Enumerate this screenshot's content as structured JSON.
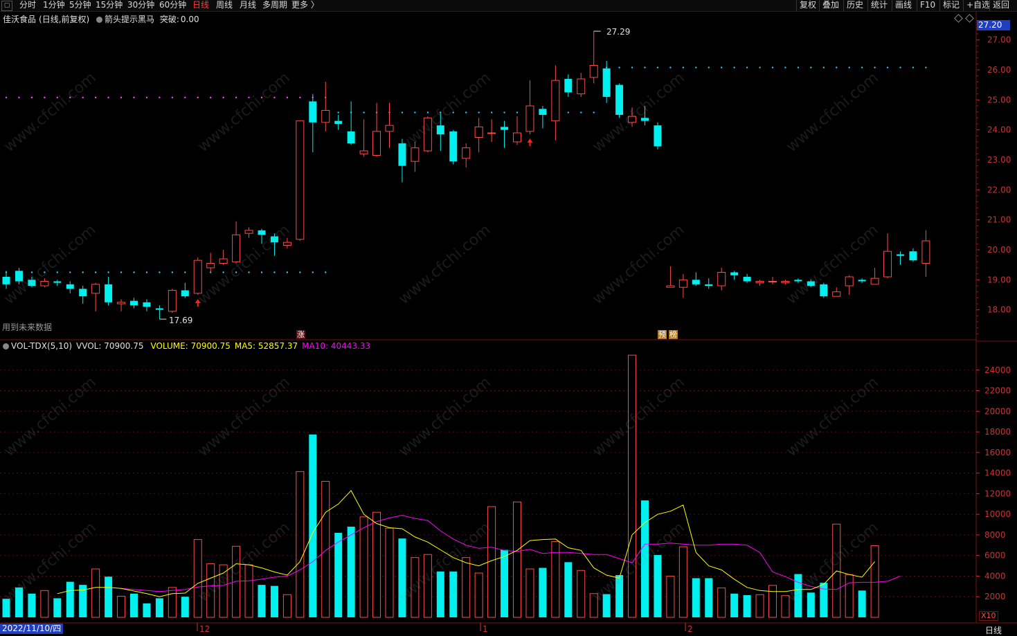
{
  "toolbar": {
    "left": [
      "分时",
      "1分钟",
      "5分钟",
      "15分钟",
      "30分钟",
      "60分钟",
      "日线",
      "周线",
      "月线",
      "多周期",
      "更多 〉"
    ],
    "active_index": 6,
    "right": [
      "复权",
      "叠加",
      "历史",
      "统计",
      "画线",
      "F10",
      "标记",
      "+自选",
      "返回"
    ]
  },
  "header": {
    "stock": "佳沃食品",
    "period": "(日线,前复权)",
    "indicator_name": "箭头提示黑马",
    "breakout_label": "突破:",
    "breakout_value": "0.00",
    "current_price_box": "27.20"
  },
  "price_panel": {
    "note": "用到未来数据",
    "high_label": "27.29",
    "low_label": "17.69",
    "y_ticks": [
      "27.00",
      "26.00",
      "25.00",
      "24.00",
      "23.00",
      "22.00",
      "21.00",
      "20.00",
      "19.00",
      "18.00"
    ],
    "markers": [
      "涨",
      "预",
      "榜"
    ]
  },
  "volume_panel": {
    "legend": {
      "title": "VOL-TDX(5,10)",
      "vvol": "VVOL: 70900.75",
      "volume": "VOLUME: 70900.75",
      "ma5": "MA5: 52857.37",
      "ma10": "MA10: 40443.33"
    },
    "y_ticks": [
      "24000",
      "22000",
      "20000",
      "18000",
      "16000",
      "14000",
      "12000",
      "10000",
      "8000",
      "6000",
      "4000",
      "2000"
    ],
    "unit": "X10"
  },
  "bottom_axis": {
    "date": "2022/11/10/四",
    "month_marks": [
      "12",
      "1",
      "2"
    ],
    "period_label": "日线"
  },
  "colors": {
    "up": "#ff4a4a",
    "down": "#00f0f0",
    "ma5": "#ffff00",
    "ma10": "#ff00ff",
    "grid": "#7a1010"
  },
  "chart_data": {
    "type": "candlestick+volume",
    "candles": [
      {
        "o": 19.1,
        "c": 18.85,
        "h": 19.3,
        "l": 18.7
      },
      {
        "o": 19.3,
        "c": 18.95,
        "h": 19.4,
        "l": 18.85
      },
      {
        "o": 19.0,
        "c": 18.8,
        "h": 19.1,
        "l": 18.75
      },
      {
        "o": 18.8,
        "c": 18.95,
        "h": 19.05,
        "l": 18.75
      },
      {
        "o": 18.95,
        "c": 18.9,
        "h": 19.0,
        "l": 18.8
      },
      {
        "o": 18.85,
        "c": 18.7,
        "h": 18.95,
        "l": 18.55
      },
      {
        "o": 18.7,
        "c": 18.45,
        "h": 18.8,
        "l": 18.2
      },
      {
        "o": 18.55,
        "c": 18.85,
        "h": 18.9,
        "l": 17.95
      },
      {
        "o": 18.85,
        "c": 18.25,
        "h": 19.1,
        "l": 18.15
      },
      {
        "o": 18.2,
        "c": 18.25,
        "h": 18.35,
        "l": 17.95
      },
      {
        "o": 18.3,
        "c": 18.15,
        "h": 18.4,
        "l": 18.05
      },
      {
        "o": 18.25,
        "c": 18.1,
        "h": 18.35,
        "l": 17.95
      },
      {
        "o": 18.05,
        "c": 18.0,
        "h": 18.15,
        "l": 17.69
      },
      {
        "o": 17.95,
        "c": 18.65,
        "h": 18.7,
        "l": 17.9
      },
      {
        "o": 18.65,
        "c": 18.45,
        "h": 18.9,
        "l": 18.4
      },
      {
        "o": 18.55,
        "c": 19.65,
        "h": 19.75,
        "l": 18.5
      },
      {
        "o": 19.4,
        "c": 19.55,
        "h": 19.9,
        "l": 19.25
      },
      {
        "o": 19.55,
        "c": 19.7,
        "h": 20.0,
        "l": 19.5
      },
      {
        "o": 19.6,
        "c": 20.5,
        "h": 20.95,
        "l": 19.55
      },
      {
        "o": 20.55,
        "c": 20.65,
        "h": 20.75,
        "l": 20.4
      },
      {
        "o": 20.65,
        "c": 20.5,
        "h": 20.7,
        "l": 20.2
      },
      {
        "o": 20.45,
        "c": 20.25,
        "h": 20.55,
        "l": 19.8
      },
      {
        "o": 20.15,
        "c": 20.25,
        "h": 20.4,
        "l": 20.05
      },
      {
        "o": 20.35,
        "c": 24.3,
        "h": 24.3,
        "l": 20.3
      },
      {
        "o": 24.95,
        "c": 24.25,
        "h": 25.2,
        "l": 23.25
      },
      {
        "o": 24.25,
        "c": 24.65,
        "h": 25.6,
        "l": 23.95
      },
      {
        "o": 24.3,
        "c": 24.2,
        "h": 24.5,
        "l": 24.0
      },
      {
        "o": 23.95,
        "c": 23.55,
        "h": 24.95,
        "l": 23.5
      },
      {
        "o": 23.2,
        "c": 23.3,
        "h": 24.35,
        "l": 23.1
      },
      {
        "o": 23.15,
        "c": 23.95,
        "h": 24.9,
        "l": 23.1
      },
      {
        "o": 23.95,
        "c": 24.15,
        "h": 24.9,
        "l": 23.4
      },
      {
        "o": 23.55,
        "c": 22.8,
        "h": 23.7,
        "l": 22.25
      },
      {
        "o": 22.95,
        "c": 23.4,
        "h": 23.6,
        "l": 22.6
      },
      {
        "o": 23.3,
        "c": 24.4,
        "h": 24.45,
        "l": 23.25
      },
      {
        "o": 24.15,
        "c": 23.85,
        "h": 24.55,
        "l": 23.3
      },
      {
        "o": 23.95,
        "c": 22.95,
        "h": 24.0,
        "l": 22.85
      },
      {
        "o": 23.05,
        "c": 23.4,
        "h": 23.55,
        "l": 22.75
      },
      {
        "o": 23.75,
        "c": 24.1,
        "h": 24.4,
        "l": 23.25
      },
      {
        "o": 23.9,
        "c": 23.9,
        "h": 24.35,
        "l": 23.6
      },
      {
        "o": 24.1,
        "c": 24.0,
        "h": 24.3,
        "l": 23.4
      },
      {
        "o": 23.6,
        "c": 23.9,
        "h": 24.45,
        "l": 23.5
      },
      {
        "o": 23.95,
        "c": 24.8,
        "h": 25.65,
        "l": 23.85
      },
      {
        "o": 24.7,
        "c": 24.5,
        "h": 24.8,
        "l": 24.05
      },
      {
        "o": 24.3,
        "c": 25.65,
        "h": 26.15,
        "l": 23.65
      },
      {
        "o": 25.7,
        "c": 25.25,
        "h": 25.85,
        "l": 25.1
      },
      {
        "o": 25.2,
        "c": 25.7,
        "h": 25.9,
        "l": 25.1
      },
      {
        "o": 25.75,
        "c": 26.15,
        "h": 27.29,
        "l": 25.55
      },
      {
        "o": 26.05,
        "c": 25.1,
        "h": 26.3,
        "l": 24.9
      },
      {
        "o": 25.5,
        "c": 24.5,
        "h": 25.55,
        "l": 24.4
      },
      {
        "o": 24.25,
        "c": 24.45,
        "h": 24.75,
        "l": 24.1
      },
      {
        "o": 24.4,
        "c": 24.3,
        "h": 24.8,
        "l": 24.15
      },
      {
        "o": 24.15,
        "c": 23.45,
        "h": 24.25,
        "l": 23.35
      },
      {
        "o": 18.75,
        "c": 18.8,
        "h": 19.45,
        "l": 18.75
      },
      {
        "o": 18.75,
        "c": 19.0,
        "h": 19.2,
        "l": 18.4
      },
      {
        "o": 19.0,
        "c": 18.85,
        "h": 19.25,
        "l": 18.8
      },
      {
        "o": 18.85,
        "c": 18.8,
        "h": 19.05,
        "l": 18.7
      },
      {
        "o": 18.8,
        "c": 19.25,
        "h": 19.4,
        "l": 18.65
      },
      {
        "o": 19.25,
        "c": 19.15,
        "h": 19.3,
        "l": 19.0
      },
      {
        "o": 19.1,
        "c": 18.95,
        "h": 19.2,
        "l": 18.9
      },
      {
        "o": 18.9,
        "c": 18.95,
        "h": 19.0,
        "l": 18.8
      },
      {
        "o": 18.95,
        "c": 18.95,
        "h": 19.1,
        "l": 18.85
      },
      {
        "o": 18.9,
        "c": 18.95,
        "h": 19.0,
        "l": 18.85
      },
      {
        "o": 19.0,
        "c": 18.95,
        "h": 19.05,
        "l": 18.9
      },
      {
        "o": 18.95,
        "c": 18.8,
        "h": 19.0,
        "l": 18.75
      },
      {
        "o": 18.85,
        "c": 18.45,
        "h": 18.9,
        "l": 18.4
      },
      {
        "o": 18.45,
        "c": 18.6,
        "h": 18.75,
        "l": 18.45
      },
      {
        "o": 18.8,
        "c": 19.1,
        "h": 19.15,
        "l": 18.5
      },
      {
        "o": 19.0,
        "c": 18.95,
        "h": 19.05,
        "l": 18.9
      },
      {
        "o": 18.85,
        "c": 19.05,
        "h": 19.4,
        "l": 18.85
      },
      {
        "o": 19.1,
        "c": 19.95,
        "h": 20.55,
        "l": 19.05
      },
      {
        "o": 19.85,
        "c": 19.8,
        "h": 19.95,
        "l": 19.5
      },
      {
        "o": 19.95,
        "c": 19.65,
        "h": 20.05,
        "l": 19.6
      },
      {
        "o": 19.55,
        "c": 20.3,
        "h": 20.65,
        "l": 19.1
      }
    ],
    "volumes": [
      1800,
      2900,
      2300,
      2600,
      1850,
      3450,
      3150,
      4700,
      3950,
      2050,
      2300,
      1350,
      1850,
      2900,
      2000,
      7550,
      5200,
      5100,
      6900,
      5100,
      3150,
      3050,
      2200,
      14150,
      17750,
      13200,
      8200,
      8800,
      9750,
      10200,
      8650,
      7650,
      5800,
      6100,
      4450,
      4450,
      5800,
      4300,
      10750,
      6550,
      11200,
      4700,
      4800,
      7350,
      5350,
      4550,
      2300,
      2250,
      4100,
      25450,
      11350,
      6050,
      4000,
      6850,
      3800,
      3800,
      2850,
      2300,
      2150,
      2200,
      3100,
      2100,
      4200,
      2400,
      3350,
      9050,
      4150,
      2600,
      6950
    ],
    "ma5": [
      null,
      null,
      null,
      null,
      2300,
      2600,
      2650,
      2900,
      2900,
      2800,
      2550,
      2300,
      2000,
      2300,
      2350,
      3300,
      3800,
      4300,
      5200,
      5100,
      4800,
      4400,
      4100,
      5400,
      8200,
      10200,
      11000,
      12300,
      10000,
      9100,
      8700,
      8600,
      7800,
      7300,
      6550,
      5800,
      5300,
      5000,
      5500,
      5900,
      6500,
      7450,
      7550,
      7600,
      6750,
      6500,
      4800,
      4100,
      3800,
      8000,
      9200,
      10000,
      10300,
      10900,
      6300,
      5000,
      4600,
      3700,
      2900,
      2600,
      2500,
      2500,
      2700,
      2700,
      3200,
      4500,
      4150,
      3900,
      5400
    ],
    "ma10": [
      null,
      null,
      null,
      null,
      null,
      null,
      null,
      null,
      null,
      2800,
      2700,
      2600,
      2500,
      2600,
      2700,
      2950,
      3050,
      3100,
      3500,
      3550,
      3700,
      3900,
      4000,
      4600,
      5400,
      6500,
      7300,
      8000,
      8700,
      9300,
      9650,
      9900,
      9600,
      9400,
      8400,
      7600,
      7000,
      6700,
      6800,
      6500,
      6400,
      6600,
      6200,
      6300,
      6300,
      6200,
      6100,
      6100,
      5700,
      5300,
      7100,
      7100,
      7200,
      7100,
      7000,
      7000,
      7100,
      7100,
      7000,
      6300,
      4400,
      3950,
      3400,
      3000,
      2750,
      2700,
      3350,
      3400,
      3400,
      3500,
      4000
    ],
    "y_ranges": {
      "price": [
        17.0,
        27.5
      ],
      "volume": [
        0,
        26000
      ]
    }
  }
}
